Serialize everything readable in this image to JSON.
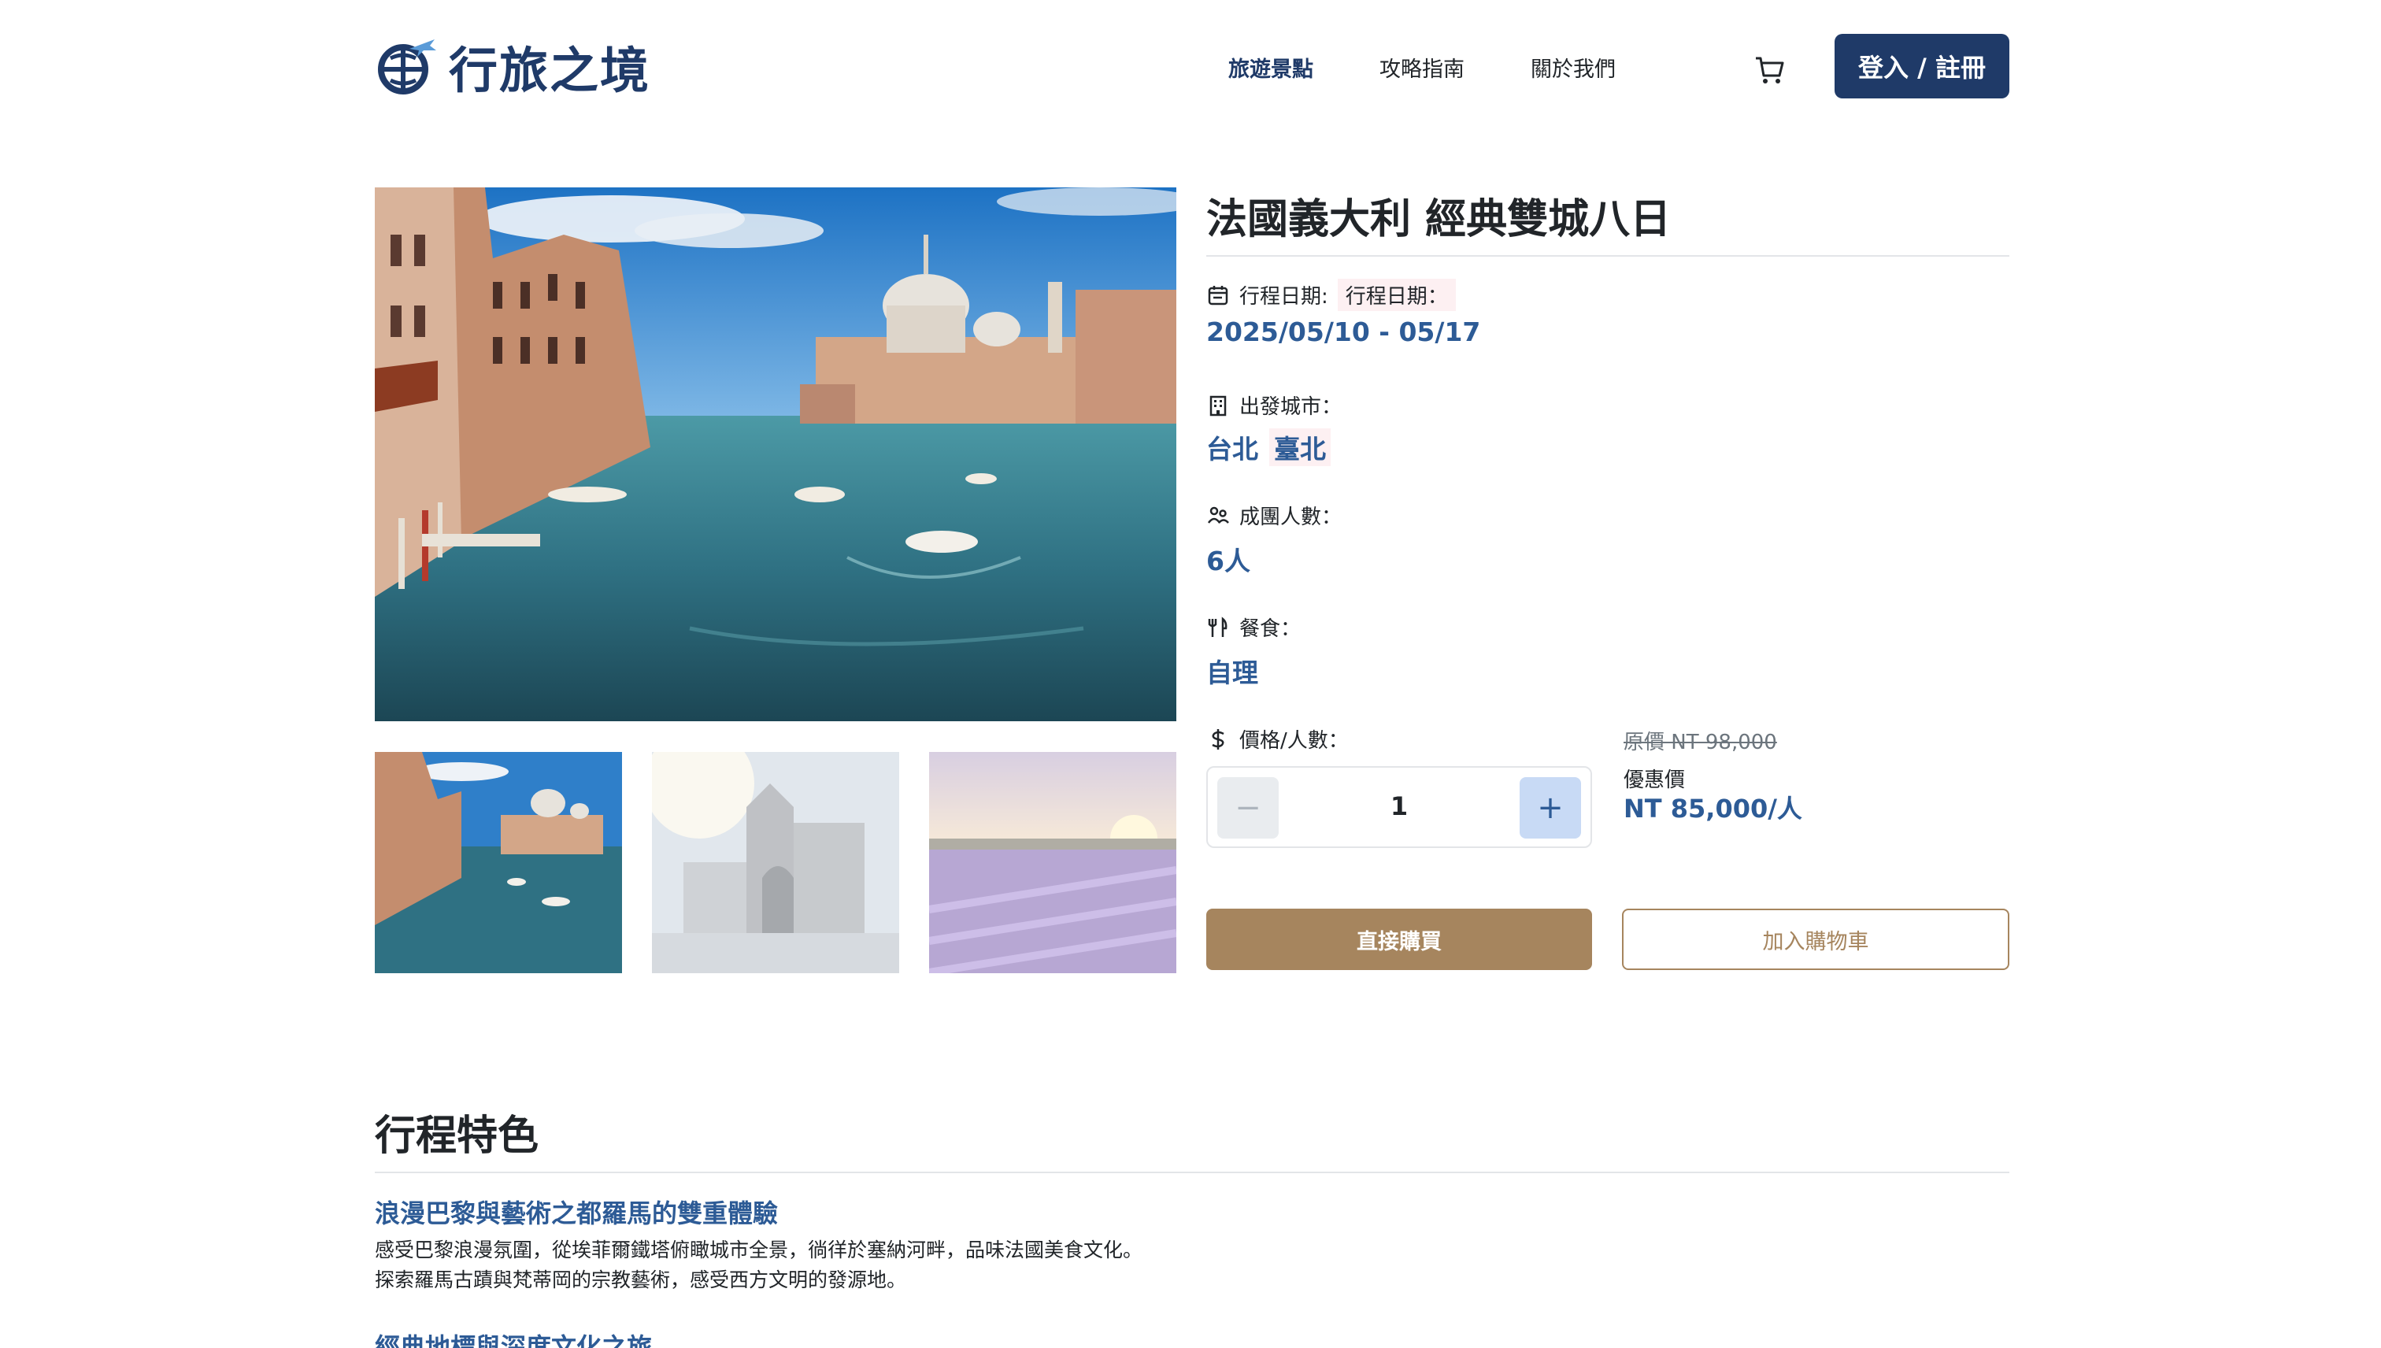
{
  "brand": {
    "name": "行旅之境",
    "color": "#1f3a68"
  },
  "nav": {
    "items": [
      "旅遊景點",
      "攻略指南",
      "關於我們"
    ],
    "active_index": 0
  },
  "header": {
    "cart_icon": "cart-icon",
    "login_label": "登入 / 註冊"
  },
  "gallery": {
    "hero": "venice-grand-canal",
    "thumbnails": [
      "venice-grand-canal",
      "french-stone-gate",
      "lavender-field-sunset"
    ]
  },
  "product": {
    "title": "法國義大利 經典雙城八日",
    "date_label": "行程日期:",
    "date_tag": "行程日期：",
    "date_value": "2025/05/10 - 05/17",
    "city_label": "出發城市：",
    "city_values": [
      "台北",
      "臺北"
    ],
    "group_label": "成團人數：",
    "group_value": "6人",
    "meal_label": "餐食：",
    "meal_value": "自理",
    "price_label": "價格/人數：",
    "quantity": "1",
    "minus_symbol": "−",
    "plus_symbol": "+",
    "original_price": "原價 NT 98,000",
    "sale_label": "優惠價",
    "sale_price": "NT 85,000/人",
    "buy_label": "直接購買",
    "add_cart_label": "加入購物車"
  },
  "features": {
    "title": "行程特色",
    "items": [
      {
        "heading": "浪漫巴黎與藝術之都羅馬的雙重體驗",
        "lines": [
          "感受巴黎浪漫氛圍，從埃菲爾鐵塔俯瞰城市全景，徜徉於塞納河畔，品味法國美食文化。",
          "探索羅馬古蹟與梵蒂岡的宗教藝術，感受西方文明的發源地。"
        ]
      },
      {
        "heading": "經典地標與深度文化之旅"
      }
    ]
  },
  "colors": {
    "accent": "#2d5b96",
    "gold": "#a6855e",
    "tag_bg": "#fdf0f2"
  }
}
